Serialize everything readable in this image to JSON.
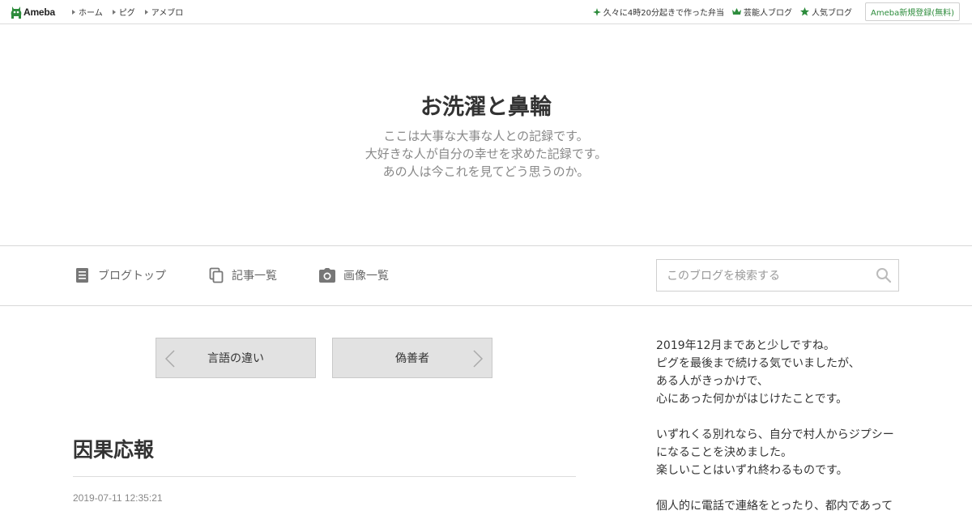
{
  "topbar": {
    "logo_text": "Ameba",
    "nav": [
      "ホーム",
      "ピグ",
      "アメブロ"
    ],
    "right_links": [
      {
        "icon": "sparkle-icon",
        "label": "久々に4時20分起きで作った弁当"
      },
      {
        "icon": "crown-icon",
        "label": "芸能人ブログ"
      },
      {
        "icon": "star-icon",
        "label": "人気ブログ"
      }
    ],
    "register_label": "Ameba新規登録(無料)"
  },
  "header": {
    "title": "お洗濯と鼻輪",
    "description": [
      "ここは大事な大事な人との記録です。",
      "大好きな人が自分の幸せを求めた記録です。",
      "あの人は今これを見てどう思うのか。"
    ]
  },
  "blog_nav": {
    "items": [
      {
        "icon": "document-icon",
        "label": "ブログトップ"
      },
      {
        "icon": "copy-icon",
        "label": "記事一覧"
      },
      {
        "icon": "camera-icon",
        "label": "画像一覧"
      }
    ],
    "search_placeholder": "このブログを検索する"
  },
  "pager": {
    "prev_label": "言語の違い",
    "next_label": "偽善者"
  },
  "article": {
    "title": "因果応報",
    "date": "2019-07-11 12:35:21"
  },
  "sidebar": {
    "paragraphs": [
      [
        "2019年12月まであと少しですね。",
        "ピグを最後まで続ける気でいましたが、",
        "ある人がきっかけで、",
        "心にあった何かがはじけたことです。"
      ],
      [
        "いずれくる別れなら、自分で村人からジプシー",
        "になることを決めました。",
        "楽しいことはいずれ終わるものです。"
      ],
      [
        "個人的に電話で連絡をとったり、都内であって"
      ]
    ]
  },
  "colors": {
    "accent_green": "#2d8c3c",
    "pager_bg": "#e2e2e2",
    "border": "#d8d8d8"
  }
}
